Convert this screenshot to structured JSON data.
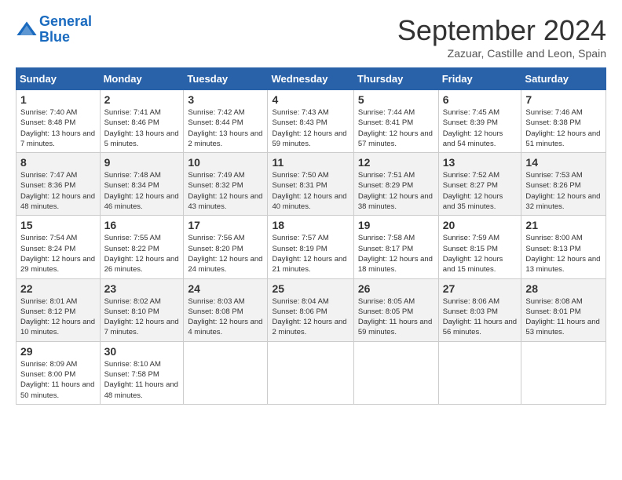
{
  "logo": {
    "line1": "General",
    "line2": "Blue"
  },
  "title": "September 2024",
  "location": "Zazuar, Castille and Leon, Spain",
  "weekdays": [
    "Sunday",
    "Monday",
    "Tuesday",
    "Wednesday",
    "Thursday",
    "Friday",
    "Saturday"
  ],
  "weeks": [
    [
      {
        "day": "1",
        "sunrise": "7:40 AM",
        "sunset": "8:48 PM",
        "daylight": "13 hours and 7 minutes."
      },
      {
        "day": "2",
        "sunrise": "7:41 AM",
        "sunset": "8:46 PM",
        "daylight": "13 hours and 5 minutes."
      },
      {
        "day": "3",
        "sunrise": "7:42 AM",
        "sunset": "8:44 PM",
        "daylight": "13 hours and 2 minutes."
      },
      {
        "day": "4",
        "sunrise": "7:43 AM",
        "sunset": "8:43 PM",
        "daylight": "12 hours and 59 minutes."
      },
      {
        "day": "5",
        "sunrise": "7:44 AM",
        "sunset": "8:41 PM",
        "daylight": "12 hours and 57 minutes."
      },
      {
        "day": "6",
        "sunrise": "7:45 AM",
        "sunset": "8:39 PM",
        "daylight": "12 hours and 54 minutes."
      },
      {
        "day": "7",
        "sunrise": "7:46 AM",
        "sunset": "8:38 PM",
        "daylight": "12 hours and 51 minutes."
      }
    ],
    [
      {
        "day": "8",
        "sunrise": "7:47 AM",
        "sunset": "8:36 PM",
        "daylight": "12 hours and 48 minutes."
      },
      {
        "day": "9",
        "sunrise": "7:48 AM",
        "sunset": "8:34 PM",
        "daylight": "12 hours and 46 minutes."
      },
      {
        "day": "10",
        "sunrise": "7:49 AM",
        "sunset": "8:32 PM",
        "daylight": "12 hours and 43 minutes."
      },
      {
        "day": "11",
        "sunrise": "7:50 AM",
        "sunset": "8:31 PM",
        "daylight": "12 hours and 40 minutes."
      },
      {
        "day": "12",
        "sunrise": "7:51 AM",
        "sunset": "8:29 PM",
        "daylight": "12 hours and 38 minutes."
      },
      {
        "day": "13",
        "sunrise": "7:52 AM",
        "sunset": "8:27 PM",
        "daylight": "12 hours and 35 minutes."
      },
      {
        "day": "14",
        "sunrise": "7:53 AM",
        "sunset": "8:26 PM",
        "daylight": "12 hours and 32 minutes."
      }
    ],
    [
      {
        "day": "15",
        "sunrise": "7:54 AM",
        "sunset": "8:24 PM",
        "daylight": "12 hours and 29 minutes."
      },
      {
        "day": "16",
        "sunrise": "7:55 AM",
        "sunset": "8:22 PM",
        "daylight": "12 hours and 26 minutes."
      },
      {
        "day": "17",
        "sunrise": "7:56 AM",
        "sunset": "8:20 PM",
        "daylight": "12 hours and 24 minutes."
      },
      {
        "day": "18",
        "sunrise": "7:57 AM",
        "sunset": "8:19 PM",
        "daylight": "12 hours and 21 minutes."
      },
      {
        "day": "19",
        "sunrise": "7:58 AM",
        "sunset": "8:17 PM",
        "daylight": "12 hours and 18 minutes."
      },
      {
        "day": "20",
        "sunrise": "7:59 AM",
        "sunset": "8:15 PM",
        "daylight": "12 hours and 15 minutes."
      },
      {
        "day": "21",
        "sunrise": "8:00 AM",
        "sunset": "8:13 PM",
        "daylight": "12 hours and 13 minutes."
      }
    ],
    [
      {
        "day": "22",
        "sunrise": "8:01 AM",
        "sunset": "8:12 PM",
        "daylight": "12 hours and 10 minutes."
      },
      {
        "day": "23",
        "sunrise": "8:02 AM",
        "sunset": "8:10 PM",
        "daylight": "12 hours and 7 minutes."
      },
      {
        "day": "24",
        "sunrise": "8:03 AM",
        "sunset": "8:08 PM",
        "daylight": "12 hours and 4 minutes."
      },
      {
        "day": "25",
        "sunrise": "8:04 AM",
        "sunset": "8:06 PM",
        "daylight": "12 hours and 2 minutes."
      },
      {
        "day": "26",
        "sunrise": "8:05 AM",
        "sunset": "8:05 PM",
        "daylight": "11 hours and 59 minutes."
      },
      {
        "day": "27",
        "sunrise": "8:06 AM",
        "sunset": "8:03 PM",
        "daylight": "11 hours and 56 minutes."
      },
      {
        "day": "28",
        "sunrise": "8:08 AM",
        "sunset": "8:01 PM",
        "daylight": "11 hours and 53 minutes."
      }
    ],
    [
      {
        "day": "29",
        "sunrise": "8:09 AM",
        "sunset": "8:00 PM",
        "daylight": "11 hours and 50 minutes."
      },
      {
        "day": "30",
        "sunrise": "8:10 AM",
        "sunset": "7:58 PM",
        "daylight": "11 hours and 48 minutes."
      },
      null,
      null,
      null,
      null,
      null
    ]
  ]
}
